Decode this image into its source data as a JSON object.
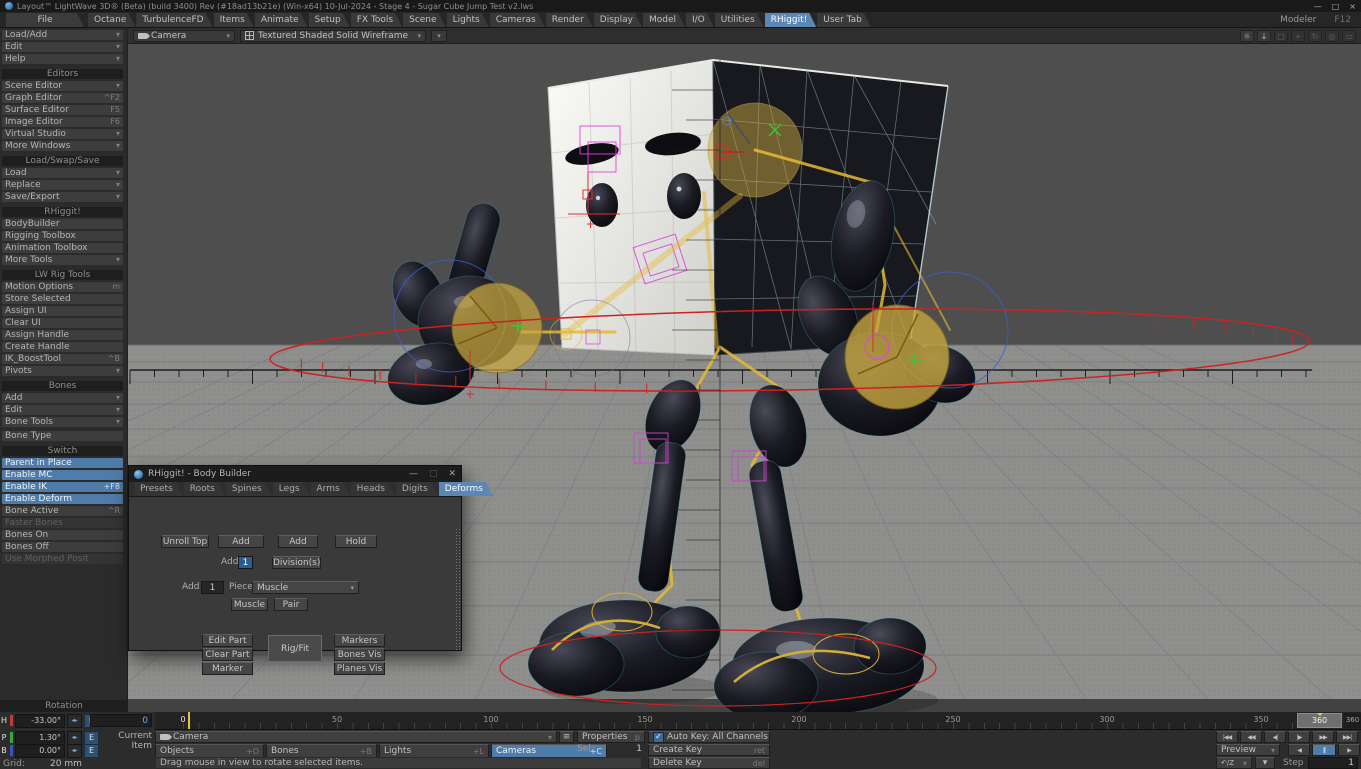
{
  "titlebar": {
    "title": "Layout™ LightWave 3D® (Beta) (build 3400) Rev (#18ad13b21e) (Win-x64) 10-Jul-2024 - Stage 4 - Sugar Cube Jump Test v2.lws",
    "minimize": "—",
    "maximize": "□",
    "close": "×"
  },
  "menubar": {
    "file": "File",
    "tabs": [
      {
        "label": "Octane"
      },
      {
        "label": "TurbulenceFD"
      },
      {
        "label": "Items"
      },
      {
        "label": "Animate"
      },
      {
        "label": "Setup"
      },
      {
        "label": "FX Tools"
      },
      {
        "label": "Scene"
      },
      {
        "label": "Lights"
      },
      {
        "label": "Cameras"
      },
      {
        "label": "Render"
      },
      {
        "label": "Display"
      },
      {
        "label": "Model"
      },
      {
        "label": "I/O"
      },
      {
        "label": "Utilities"
      },
      {
        "label": "RHiggit!",
        "active": true
      },
      {
        "label": "User Tab"
      }
    ],
    "modeler": "Modeler",
    "modeler_shortcut": "F12"
  },
  "viewport_bar": {
    "camera": "Camera",
    "mode": "Textured Shaded Solid Wireframe",
    "gear_icon_glyph": "☼",
    "save_icon_glyph": "↓",
    "extra_icon_glyphs": [
      "□",
      "+",
      "↻",
      "◎",
      "▭"
    ]
  },
  "sidebar": {
    "rows": [
      {
        "label": "Load/Add",
        "suffix": "▾"
      },
      {
        "label": "Edit",
        "suffix": "▾"
      },
      {
        "label": "Help",
        "suffix": "▾"
      },
      {
        "label": "Editors",
        "header": true
      },
      {
        "label": "Scene Editor",
        "suffix": "▾"
      },
      {
        "label": "Graph Editor",
        "suffix": "^F2"
      },
      {
        "label": "Surface Editor",
        "suffix": "F5"
      },
      {
        "label": "Image Editor",
        "suffix": "F6"
      },
      {
        "label": "Virtual Studio",
        "suffix": "▾"
      },
      {
        "label": "More Windows",
        "suffix": "▾"
      },
      {
        "label": "Load/Swap/Save",
        "header": true
      },
      {
        "label": "Load",
        "suffix": "▾"
      },
      {
        "label": "Replace",
        "suffix": "▾"
      },
      {
        "label": "Save/Export",
        "suffix": "▾"
      },
      {
        "label": "RHiggit!",
        "header": true
      },
      {
        "label": "BodyBuilder"
      },
      {
        "label": "Rigging Toolbox"
      },
      {
        "label": "Animation Toolbox"
      },
      {
        "label": "More Tools",
        "suffix": "▾"
      },
      {
        "label": "LW Rig Tools",
        "header": true
      },
      {
        "label": "Motion Options",
        "suffix": "m"
      },
      {
        "label": "Store Selected"
      },
      {
        "label": "Assign UI"
      },
      {
        "label": "Clear UI"
      },
      {
        "label": "Assign Handle"
      },
      {
        "label": "Create Handle"
      },
      {
        "label": "IK_BoostTool",
        "suffix": "^B"
      },
      {
        "label": "Pivots",
        "suffix": "▾"
      },
      {
        "label": "Bones",
        "header": true
      },
      {
        "label": "Add",
        "suffix": "▾"
      },
      {
        "label": "Edit",
        "suffix": "▾"
      },
      {
        "label": "Bone Tools",
        "suffix": "▾"
      },
      {
        "label": "Bone Type",
        "gap": true
      },
      {
        "label": "Switch",
        "header": true
      },
      {
        "label": "Parent in Place",
        "highlight": true
      },
      {
        "label": "Enable MC",
        "highlight": true
      },
      {
        "label": "Enable IK",
        "suffix": "+F8",
        "highlight": true
      },
      {
        "label": "Enable Deform",
        "highlight": true
      },
      {
        "label": "Bone Active",
        "suffix": "^R"
      },
      {
        "label": "Faster Bones",
        "disabled": true
      },
      {
        "label": "Bones On"
      },
      {
        "label": "Bones Off"
      },
      {
        "label": "Use Morphed Posit",
        "disabled": true
      }
    ]
  },
  "dialog": {
    "title": "RHiggit! - Body Builder",
    "minimize": "—",
    "maximize": "□",
    "close": "✕",
    "tabs": [
      {
        "label": "Presets"
      },
      {
        "label": "Roots"
      },
      {
        "label": "Spines"
      },
      {
        "label": "Legs"
      },
      {
        "label": "Arms"
      },
      {
        "label": "Heads"
      },
      {
        "label": "Digits"
      },
      {
        "label": "Deforms",
        "active": true
      }
    ],
    "top_buttons": [
      {
        "label": "Unroll Top"
      },
      {
        "label": "Add Spacer"
      },
      {
        "label": "Add Hold"
      },
      {
        "label": "Hold Pair"
      }
    ],
    "divisions": {
      "add_label": "Add",
      "value": "1",
      "button": "Division(s)"
    },
    "piece": {
      "add_label": "Add",
      "value": "1",
      "piece_label": "Piece",
      "selected": "Muscle"
    },
    "muscle_button": "Muscle",
    "pair_button": "Pair",
    "part_buttons": [
      {
        "label": "Edit Part"
      },
      {
        "label": "Clear Part"
      },
      {
        "label": "Marker Sym"
      }
    ],
    "rigfit_button": "Rig/Fit",
    "vis_buttons": [
      {
        "label": "Markers Vis"
      },
      {
        "label": "Bones Vis"
      },
      {
        "label": "Planes Vis"
      }
    ]
  },
  "timeline": {
    "current_frame": "0",
    "marker_label": "0",
    "labels": [
      "0",
      "50",
      "100",
      "150",
      "200",
      "250",
      "300",
      "350"
    ],
    "end_handle": "360",
    "end_value": "360"
  },
  "bottom": {
    "rotation_header": "Rotation",
    "channels": [
      {
        "label": "H",
        "value": "-33.00°",
        "color": "#c23a3a"
      },
      {
        "label": "P",
        "value": "1.30°",
        "color": "#3aa83a"
      },
      {
        "label": "B",
        "value": "0.00°",
        "color": "#3a55c2"
      }
    ],
    "minislider_glyph": "◂▸",
    "envelope_label": "E",
    "grid_label": "Grid:",
    "grid_value": "20 mm",
    "current_item_label": "Current Item",
    "current_item": "Camera",
    "list_icon_glyph": "≡",
    "properties": "Properties",
    "properties_shortcut": "p",
    "select_buttons": [
      {
        "label": "Objects",
        "shortcut": "+O"
      },
      {
        "label": "Bones",
        "shortcut": "+B"
      },
      {
        "label": "Lights",
        "shortcut": "+L"
      },
      {
        "label": "Cameras",
        "shortcut": "+C",
        "active": true
      }
    ],
    "sel_label": "Sel:",
    "sel_value": "1",
    "autokey_label": "Auto Key: All Channels",
    "create_key": {
      "label": "Create Key",
      "shortcut": "ret"
    },
    "delete_key": {
      "label": "Delete Key",
      "shortcut": "del"
    },
    "status": "Drag mouse in view to rotate selected items.",
    "transport": [
      "|◀◀",
      "◀◀",
      "◀|",
      "|▶",
      "▶▶",
      "▶▶|"
    ],
    "preview_label": "Preview",
    "play": {
      "reverse": "◀",
      "pause": "‖",
      "forward": "▶"
    },
    "undo_label": "↶/Z",
    "step_label": "Step",
    "step_value": "1"
  },
  "ui": {
    "dropdown_arrow": "▾",
    "check": "✓"
  },
  "colors": {
    "accent_blue": "#5b87b5",
    "switch_highlight": "#4f7ca8",
    "autokey_checkbox": "#3d6a9e",
    "rig_control_yellow": "#c9a83f",
    "rig_bone_yellow": "#e6b832",
    "rig_ring_red": "#cc2222",
    "rig_box_magenta": "#e040e0",
    "rig_circle_blue": "#3a5fd0",
    "channel_h": "#c23a3a",
    "channel_p": "#3aa83a",
    "channel_b": "#3a55c2"
  }
}
